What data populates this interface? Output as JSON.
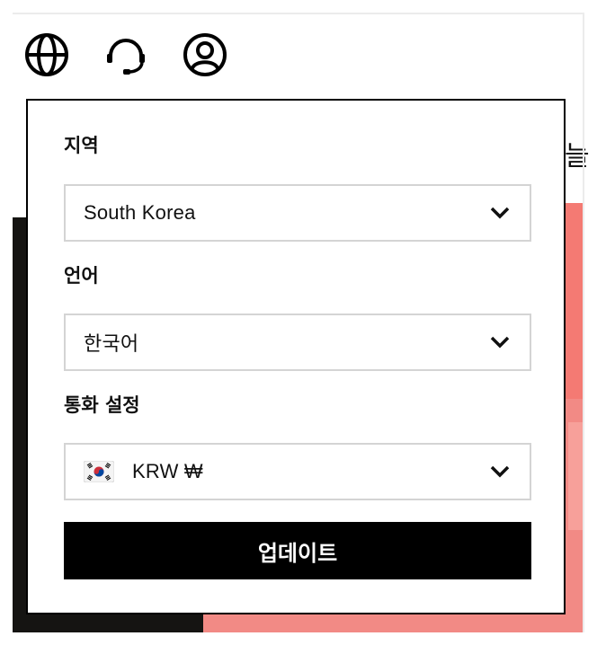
{
  "header": {
    "icons": [
      "globe-icon",
      "headset-icon",
      "account-icon"
    ]
  },
  "background": {
    "nav_glyph": "늘"
  },
  "settings_panel": {
    "region": {
      "label": "지역",
      "value": "South Korea"
    },
    "language": {
      "label": "언어",
      "value": "한국어"
    },
    "currency": {
      "label": "통화 설정",
      "value": "KRW ₩",
      "flag": "korea-flag-icon"
    },
    "update_label": "업데이트"
  },
  "colors": {
    "panel_border": "#000000",
    "button_bg": "#000000",
    "button_text": "#ffffff",
    "select_border": "#d4d4d4",
    "bg_dark": "#151412",
    "bg_accent": "#f47a73"
  }
}
